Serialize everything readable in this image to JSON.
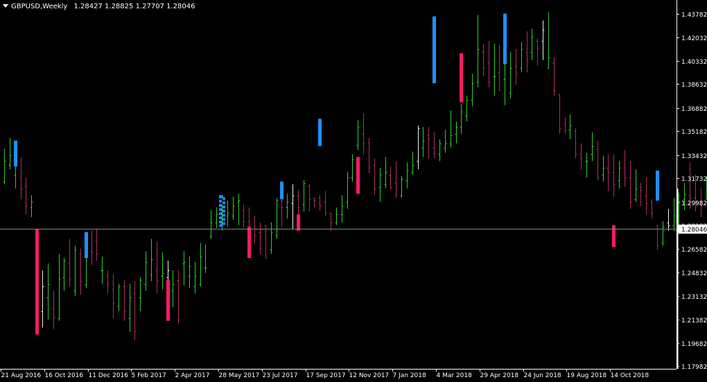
{
  "window": {
    "symbol": "GBPUSD",
    "timeframe": "Weekly",
    "ohlc": [
      "1.28427",
      "1.28825",
      "1.27707",
      "1.28046"
    ]
  },
  "colors": {
    "background": "#000000",
    "axis": "#ffffff",
    "bull": "#32cd32",
    "bear": "#b03060",
    "white_bar": "#f0f0f0",
    "highlight_up": "#1e90ff",
    "highlight_down": "#ff1a66",
    "price_line": "#778899",
    "price_label_bg": "#ffffff",
    "price_label_text": "#000000"
  },
  "chart_data": {
    "type": "ohlc",
    "symbol": "GBPUSD",
    "timeframe": "Weekly",
    "current_price": 1.28046,
    "current_price_label": "1.28046",
    "ylim": [
      1.1778,
      1.448
    ],
    "y_ticks": [
      "1.43782",
      "1.42032",
      "1.40332",
      "1.38632",
      "1.36882",
      "1.35182",
      "1.33432",
      "1.31732",
      "1.29982",
      "1.28282",
      "1.26582",
      "1.24832",
      "1.23132",
      "1.21382",
      "1.19682",
      "1.17982"
    ],
    "x_ticks": [
      "21 Aug 2016",
      "16 Oct 2016",
      "11 Dec 2016",
      "5 Feb 2017",
      "2 Apr 2017",
      "28 May 2017",
      "23 Jul 2017",
      "17 Sep 2017",
      "12 Nov 2017",
      "7 Jan 2018",
      "4 Mar 2018",
      "29 Apr 2018",
      "24 Jun 2018",
      "19 Aug 2018",
      "14 Oct 2018"
    ],
    "bars_per_tick": 8,
    "bars": [
      [
        1.315,
        1.339,
        1.313,
        1.33
      ],
      [
        1.327,
        1.347,
        1.324,
        1.334
      ],
      [
        1.32,
        1.337,
        1.31,
        1.33
      ],
      [
        1.318,
        1.333,
        1.302,
        1.31
      ],
      [
        1.312,
        1.318,
        1.291,
        1.297
      ],
      [
        1.296,
        1.305,
        1.289,
        1.3
      ],
      [
        1.28,
        1.28,
        1.202,
        1.22
      ],
      [
        1.22,
        1.25,
        1.208,
        1.238
      ],
      [
        1.23,
        1.255,
        1.214,
        1.24
      ],
      [
        1.222,
        1.235,
        1.207,
        1.216
      ],
      [
        1.215,
        1.262,
        1.213,
        1.244
      ],
      [
        1.245,
        1.259,
        1.235,
        1.257
      ],
      [
        1.255,
        1.273,
        1.238,
        1.244
      ],
      [
        1.235,
        1.268,
        1.231,
        1.265
      ],
      [
        1.262,
        1.266,
        1.232,
        1.242
      ],
      [
        1.24,
        1.276,
        1.237,
        1.261
      ],
      [
        1.264,
        1.279,
        1.254,
        1.263
      ],
      [
        1.272,
        1.28,
        1.257,
        1.262
      ],
      [
        1.25,
        1.26,
        1.24,
        1.25
      ],
      [
        1.246,
        1.25,
        1.233,
        1.24
      ],
      [
        1.236,
        1.247,
        1.215,
        1.226
      ],
      [
        1.224,
        1.24,
        1.22,
        1.238
      ],
      [
        1.238,
        1.243,
        1.213,
        1.22
      ],
      [
        1.215,
        1.24,
        1.205,
        1.23
      ],
      [
        1.233,
        1.242,
        1.199,
        1.205
      ],
      [
        1.23,
        1.245,
        1.22,
        1.243
      ],
      [
        1.24,
        1.264,
        1.235,
        1.256
      ],
      [
        1.247,
        1.273,
        1.242,
        1.258
      ],
      [
        1.25,
        1.271,
        1.233,
        1.243
      ],
      [
        1.246,
        1.263,
        1.236,
        1.248
      ],
      [
        1.245,
        1.257,
        1.229,
        1.25
      ],
      [
        1.235,
        1.25,
        1.223,
        1.24
      ],
      [
        1.243,
        1.25,
        1.211,
        1.214
      ],
      [
        1.255,
        1.264,
        1.239,
        1.256
      ],
      [
        1.246,
        1.26,
        1.237,
        1.253
      ],
      [
        1.238,
        1.256,
        1.233,
        1.246
      ],
      [
        1.24,
        1.27,
        1.238,
        1.26
      ],
      [
        1.252,
        1.269,
        1.248,
        1.252
      ],
      [
        1.275,
        1.294,
        1.273,
        1.285
      ],
      [
        1.285,
        1.296,
        1.281,
        1.291
      ],
      [
        1.288,
        1.298,
        1.279,
        1.293
      ],
      [
        1.29,
        1.301,
        1.282,
        1.292
      ],
      [
        1.29,
        1.304,
        1.287,
        1.297
      ],
      [
        1.3,
        1.306,
        1.283,
        1.301
      ],
      [
        1.294,
        1.298,
        1.281,
        1.286
      ],
      [
        1.286,
        1.296,
        1.279,
        1.28
      ],
      [
        1.282,
        1.29,
        1.27,
        1.276
      ],
      [
        1.278,
        1.285,
        1.262,
        1.266
      ],
      [
        1.283,
        1.283,
        1.259,
        1.259
      ],
      [
        1.265,
        1.285,
        1.262,
        1.278
      ],
      [
        1.276,
        1.303,
        1.273,
        1.301
      ],
      [
        1.301,
        1.305,
        1.282,
        1.296
      ],
      [
        1.296,
        1.306,
        1.288,
        1.3
      ],
      [
        1.299,
        1.313,
        1.28,
        1.305
      ],
      [
        1.305,
        1.309,
        1.286,
        1.296
      ],
      [
        1.298,
        1.316,
        1.293,
        1.314
      ],
      [
        1.312,
        1.313,
        1.293,
        1.302
      ],
      [
        1.303,
        1.303,
        1.296,
        1.301
      ],
      [
        1.303,
        1.305,
        1.294,
        1.297
      ],
      [
        1.3,
        1.308,
        1.29,
        1.292
      ],
      [
        1.292,
        1.292,
        1.279,
        1.285
      ],
      [
        1.285,
        1.296,
        1.283,
        1.291
      ],
      [
        1.291,
        1.305,
        1.285,
        1.297
      ],
      [
        1.3,
        1.322,
        1.295,
        1.318
      ],
      [
        1.318,
        1.335,
        1.315,
        1.331
      ],
      [
        1.342,
        1.36,
        1.338,
        1.355
      ],
      [
        1.35,
        1.365,
        1.335,
        1.343
      ],
      [
        1.344,
        1.347,
        1.321,
        1.325
      ],
      [
        1.327,
        1.332,
        1.305,
        1.31
      ],
      [
        1.311,
        1.325,
        1.3,
        1.32
      ],
      [
        1.313,
        1.333,
        1.31,
        1.322
      ],
      [
        1.32,
        1.326,
        1.309,
        1.311
      ],
      [
        1.314,
        1.33,
        1.303,
        1.306
      ],
      [
        1.305,
        1.319,
        1.303,
        1.317
      ],
      [
        1.316,
        1.329,
        1.31,
        1.323
      ],
      [
        1.322,
        1.337,
        1.32,
        1.327
      ],
      [
        1.33,
        1.356,
        1.324,
        1.354
      ],
      [
        1.34,
        1.355,
        1.333,
        1.345
      ],
      [
        1.349,
        1.355,
        1.332,
        1.346
      ],
      [
        1.34,
        1.351,
        1.332,
        1.336
      ],
      [
        1.335,
        1.346,
        1.33,
        1.343
      ],
      [
        1.34,
        1.353,
        1.336,
        1.343
      ],
      [
        1.343,
        1.367,
        1.34,
        1.349
      ],
      [
        1.35,
        1.359,
        1.343,
        1.355
      ],
      [
        1.355,
        1.372,
        1.35,
        1.366
      ],
      [
        1.363,
        1.378,
        1.359,
        1.375
      ],
      [
        1.375,
        1.394,
        1.37,
        1.387
      ],
      [
        1.388,
        1.437,
        1.384,
        1.412
      ],
      [
        1.41,
        1.416,
        1.392,
        1.398
      ],
      [
        1.402,
        1.418,
        1.384,
        1.388
      ],
      [
        1.392,
        1.416,
        1.378,
        1.392
      ],
      [
        1.395,
        1.415,
        1.382,
        1.382
      ],
      [
        1.39,
        1.411,
        1.371,
        1.405
      ],
      [
        1.38,
        1.41,
        1.376,
        1.398
      ],
      [
        1.4,
        1.412,
        1.386,
        1.394
      ],
      [
        1.398,
        1.417,
        1.395,
        1.412
      ],
      [
        1.41,
        1.425,
        1.395,
        1.405
      ],
      [
        1.41,
        1.427,
        1.404,
        1.421
      ],
      [
        1.418,
        1.42,
        1.4,
        1.413
      ],
      [
        1.418,
        1.433,
        1.404,
        1.426
      ],
      [
        1.398,
        1.439,
        1.398,
        1.406
      ],
      [
        1.402,
        1.406,
        1.378,
        1.382
      ],
      [
        1.379,
        1.379,
        1.35,
        1.354
      ],
      [
        1.357,
        1.362,
        1.35,
        1.353
      ],
      [
        1.353,
        1.364,
        1.346,
        1.356
      ],
      [
        1.352,
        1.354,
        1.332,
        1.335
      ],
      [
        1.335,
        1.343,
        1.324,
        1.332
      ],
      [
        1.33,
        1.336,
        1.318,
        1.33
      ],
      [
        1.335,
        1.351,
        1.33,
        1.341
      ],
      [
        1.339,
        1.345,
        1.316,
        1.318
      ],
      [
        1.32,
        1.334,
        1.315,
        1.325
      ],
      [
        1.325,
        1.335,
        1.308,
        1.322
      ],
      [
        1.322,
        1.335,
        1.304,
        1.313
      ],
      [
        1.316,
        1.33,
        1.31,
        1.325
      ],
      [
        1.325,
        1.338,
        1.311,
        1.318
      ],
      [
        1.318,
        1.33,
        1.295,
        1.3
      ],
      [
        1.302,
        1.324,
        1.3,
        1.31
      ],
      [
        1.311,
        1.314,
        1.297,
        1.309
      ],
      [
        1.305,
        1.318,
        1.291,
        1.299
      ],
      [
        1.3,
        1.302,
        1.288,
        1.292
      ],
      [
        1.283,
        1.283,
        1.265,
        1.268
      ],
      [
        1.27,
        1.286,
        1.268,
        1.282
      ],
      [
        1.285,
        1.295,
        1.279,
        1.283
      ],
      [
        1.283,
        1.303,
        1.279,
        1.29
      ],
      [
        1.29,
        1.307,
        1.283,
        1.3
      ],
      [
        1.302,
        1.314,
        1.294,
        1.306
      ],
      [
        1.305,
        1.329,
        1.295,
        1.303
      ],
      [
        1.303,
        1.32,
        1.293,
        1.3
      ],
      [
        1.3,
        1.31,
        1.289,
        1.297
      ],
      [
        1.302,
        1.319,
        1.302,
        1.317
      ],
      [
        1.305,
        1.32,
        1.297,
        1.31
      ],
      [
        1.31,
        1.315,
        1.28,
        1.286
      ],
      [
        1.285,
        1.292,
        1.27,
        1.282
      ],
      [
        1.284,
        1.315,
        1.278,
        1.304
      ],
      [
        1.3,
        1.308,
        1.27,
        1.284
      ],
      [
        1.283,
        1.292,
        1.277,
        1.288
      ],
      [
        1.284,
        1.288,
        1.277,
        1.28
      ]
    ],
    "highlights": [
      {
        "bar": 2,
        "top": 1.345,
        "bottom": 1.326,
        "dir": "up"
      },
      {
        "bar": 6,
        "top": 1.28,
        "bottom": 1.203,
        "dir": "down"
      },
      {
        "bar": 15,
        "top": 1.278,
        "bottom": 1.259,
        "dir": "up"
      },
      {
        "bar": 30,
        "top": 1.243,
        "bottom": 1.213,
        "dir": "down"
      },
      {
        "bar": 40,
        "top": 1.304,
        "bottom": 1.283,
        "dir": "up_dashed"
      },
      {
        "bar": 45,
        "top": 1.282,
        "bottom": 1.259,
        "dir": "down"
      },
      {
        "bar": 51,
        "top": 1.315,
        "bottom": 1.302,
        "dir": "up"
      },
      {
        "bar": 54,
        "top": 1.291,
        "bottom": 1.279,
        "dir": "down"
      },
      {
        "bar": 58,
        "top": 1.361,
        "bottom": 1.341,
        "dir": "up"
      },
      {
        "bar": 65,
        "top": 1.333,
        "bottom": 1.306,
        "dir": "down"
      },
      {
        "bar": 79,
        "top": 1.436,
        "bottom": 1.387,
        "dir": "up"
      },
      {
        "bar": 84,
        "top": 1.409,
        "bottom": 1.373,
        "dir": "down"
      },
      {
        "bar": 92,
        "top": 1.438,
        "bottom": 1.401,
        "dir": "up"
      },
      {
        "bar": 112,
        "top": 1.283,
        "bottom": 1.267,
        "dir": "down"
      },
      {
        "bar": 120,
        "top": 1.323,
        "bottom": 1.301,
        "dir": "up"
      }
    ]
  }
}
